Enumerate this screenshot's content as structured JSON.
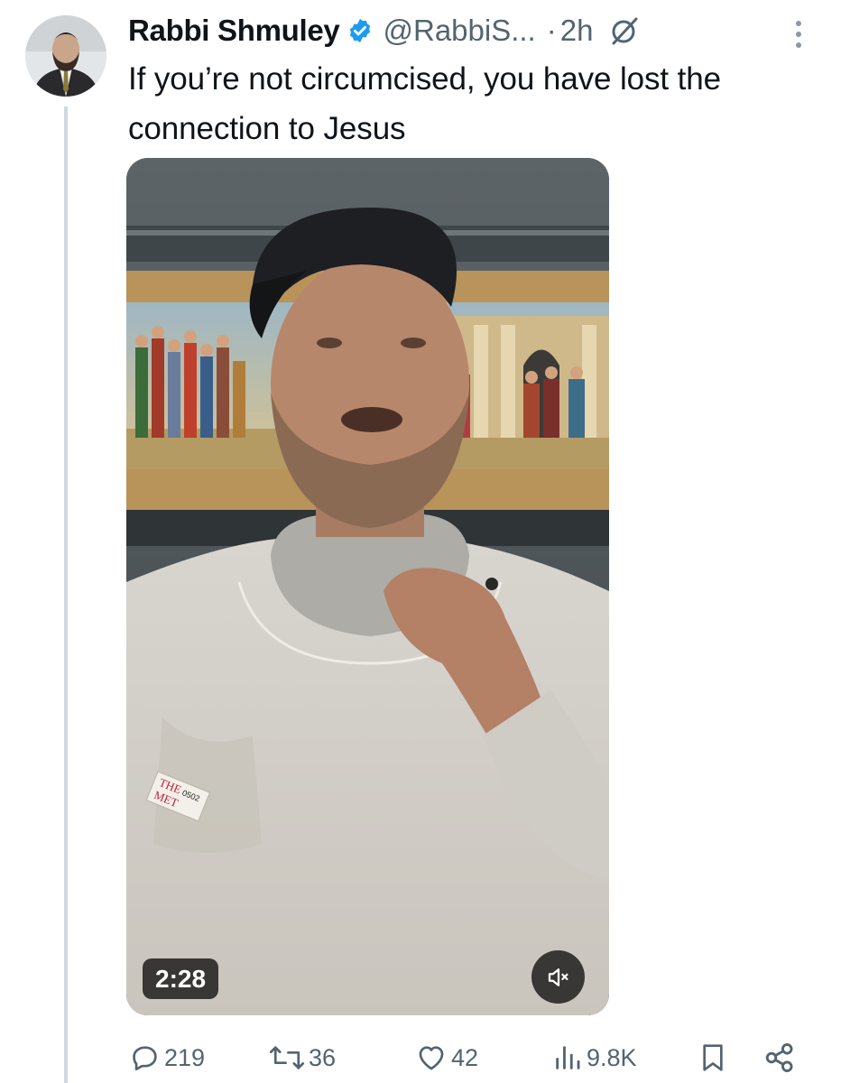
{
  "tweet": {
    "author_name": "Rabbi Shmuley",
    "handle": "@RabbiS...",
    "separator": "·",
    "time": "2h",
    "text": "If you’re not circumcised, you have lost the connection to Jesus",
    "verified": true
  },
  "media": {
    "duration": "2:28",
    "mute_icon": "speaker-muted-icon",
    "badge_text_lines": [
      "THE",
      "MET",
      "0502"
    ]
  },
  "actions": {
    "replies": "219",
    "reposts": "36",
    "likes": "42",
    "views": "9.8K"
  },
  "colors": {
    "verified_blue": "#1d9bf0",
    "secondary_text": "#536471",
    "thread_line": "#cfd9de",
    "overlay": "#000000"
  }
}
